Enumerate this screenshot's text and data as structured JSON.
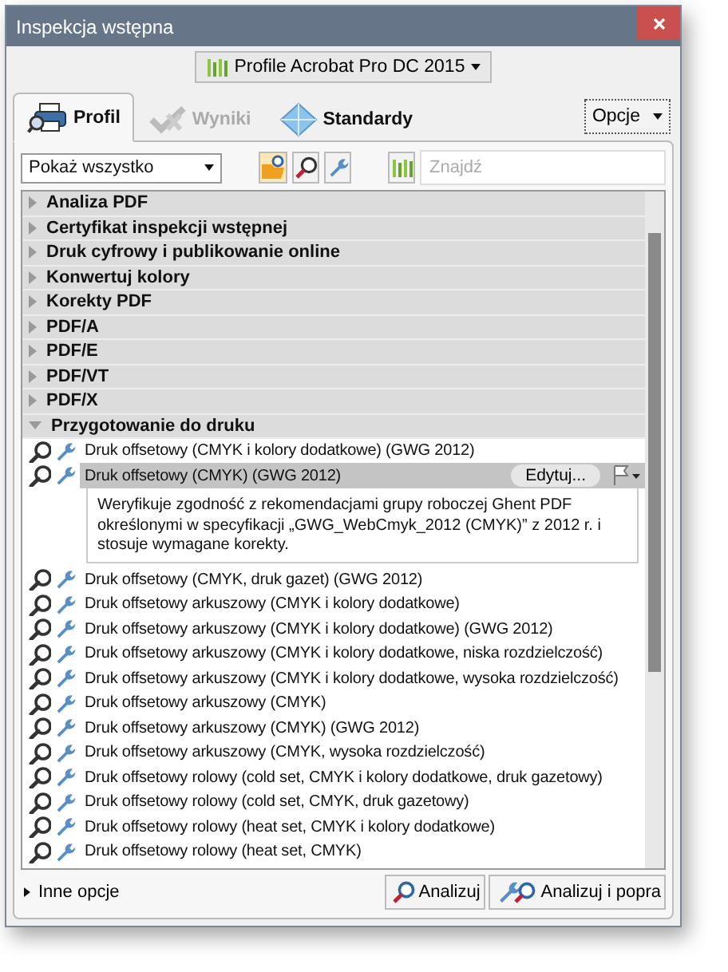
{
  "window": {
    "title": "Inspekcja wstępna"
  },
  "profile_menu": {
    "label": "Profile Acrobat Pro DC 2015"
  },
  "tabs": [
    {
      "label": "Profil",
      "selected": true,
      "disabled": false,
      "kind": "profile"
    },
    {
      "label": "Wyniki",
      "selected": false,
      "disabled": true,
      "kind": "results"
    },
    {
      "label": "Standardy",
      "selected": false,
      "disabled": false,
      "kind": "standards"
    }
  ],
  "options_button": {
    "label": "Opcje"
  },
  "filter": {
    "value": "Pokaż wszystko"
  },
  "search": {
    "placeholder": "Znajdź"
  },
  "tree": [
    {
      "label": "Analiza PDF",
      "expanded": false
    },
    {
      "label": "Certyfikat inspekcji wstępnej",
      "expanded": false
    },
    {
      "label": "Druk cyfrowy i publikowanie online",
      "expanded": false
    },
    {
      "label": "Konwertuj kolory",
      "expanded": false
    },
    {
      "label": "Korekty PDF",
      "expanded": false
    },
    {
      "label": "PDF/A",
      "expanded": false
    },
    {
      "label": "PDF/E",
      "expanded": false
    },
    {
      "label": "PDF/VT",
      "expanded": false
    },
    {
      "label": "PDF/X",
      "expanded": false
    },
    {
      "label": "Przygotowanie do druku",
      "expanded": true,
      "children": [
        {
          "label": "Druk offsetowy (CMYK i kolory dodatkowe) (GWG 2012)",
          "selected": false
        },
        {
          "label": "Druk offsetowy (CMYK) (GWG 2012)",
          "selected": true,
          "edit_button": "Edytuj...",
          "description": "Weryfikuje zgodność z rekomendacjami grupy roboczej Ghent PDF określonymi w specyfikacji „GWG_WebCmyk_2012 (CMYK)” z 2012 r. i stosuje wymagane korekty."
        },
        {
          "label": "Druk offsetowy (CMYK, druk gazet) (GWG 2012)",
          "selected": false
        },
        {
          "label": "Druk offsetowy arkuszowy (CMYK i kolory dodatkowe)",
          "selected": false
        },
        {
          "label": "Druk offsetowy arkuszowy (CMYK i kolory dodatkowe) (GWG 2012)",
          "selected": false
        },
        {
          "label": "Druk offsetowy arkuszowy (CMYK i kolory dodatkowe, niska rozdzielczość)",
          "selected": false
        },
        {
          "label": "Druk offsetowy arkuszowy (CMYK i kolory dodatkowe, wysoka rozdzielczość)",
          "selected": false
        },
        {
          "label": "Druk offsetowy arkuszowy (CMYK)",
          "selected": false
        },
        {
          "label": "Druk offsetowy arkuszowy (CMYK) (GWG 2012)",
          "selected": false
        },
        {
          "label": "Druk offsetowy arkuszowy (CMYK, wysoka rozdzielczość)",
          "selected": false
        },
        {
          "label": "Druk offsetowy rolowy (cold set, CMYK i kolory dodatkowe, druk gazetowy)",
          "selected": false
        },
        {
          "label": "Druk offsetowy rolowy (cold set, CMYK, druk gazetowy)",
          "selected": false
        },
        {
          "label": "Druk offsetowy rolowy (heat set, CMYK i kolory dodatkowe)",
          "selected": false
        },
        {
          "label": "Druk offsetowy rolowy (heat set, CMYK)",
          "selected": false
        }
      ]
    }
  ],
  "more_options": {
    "label": "Inne opcje",
    "expanded": false
  },
  "buttons": [
    {
      "label": "Analizuj",
      "kind": "analyze"
    },
    {
      "label": "Analizuj i popra",
      "kind": "fix"
    }
  ]
}
